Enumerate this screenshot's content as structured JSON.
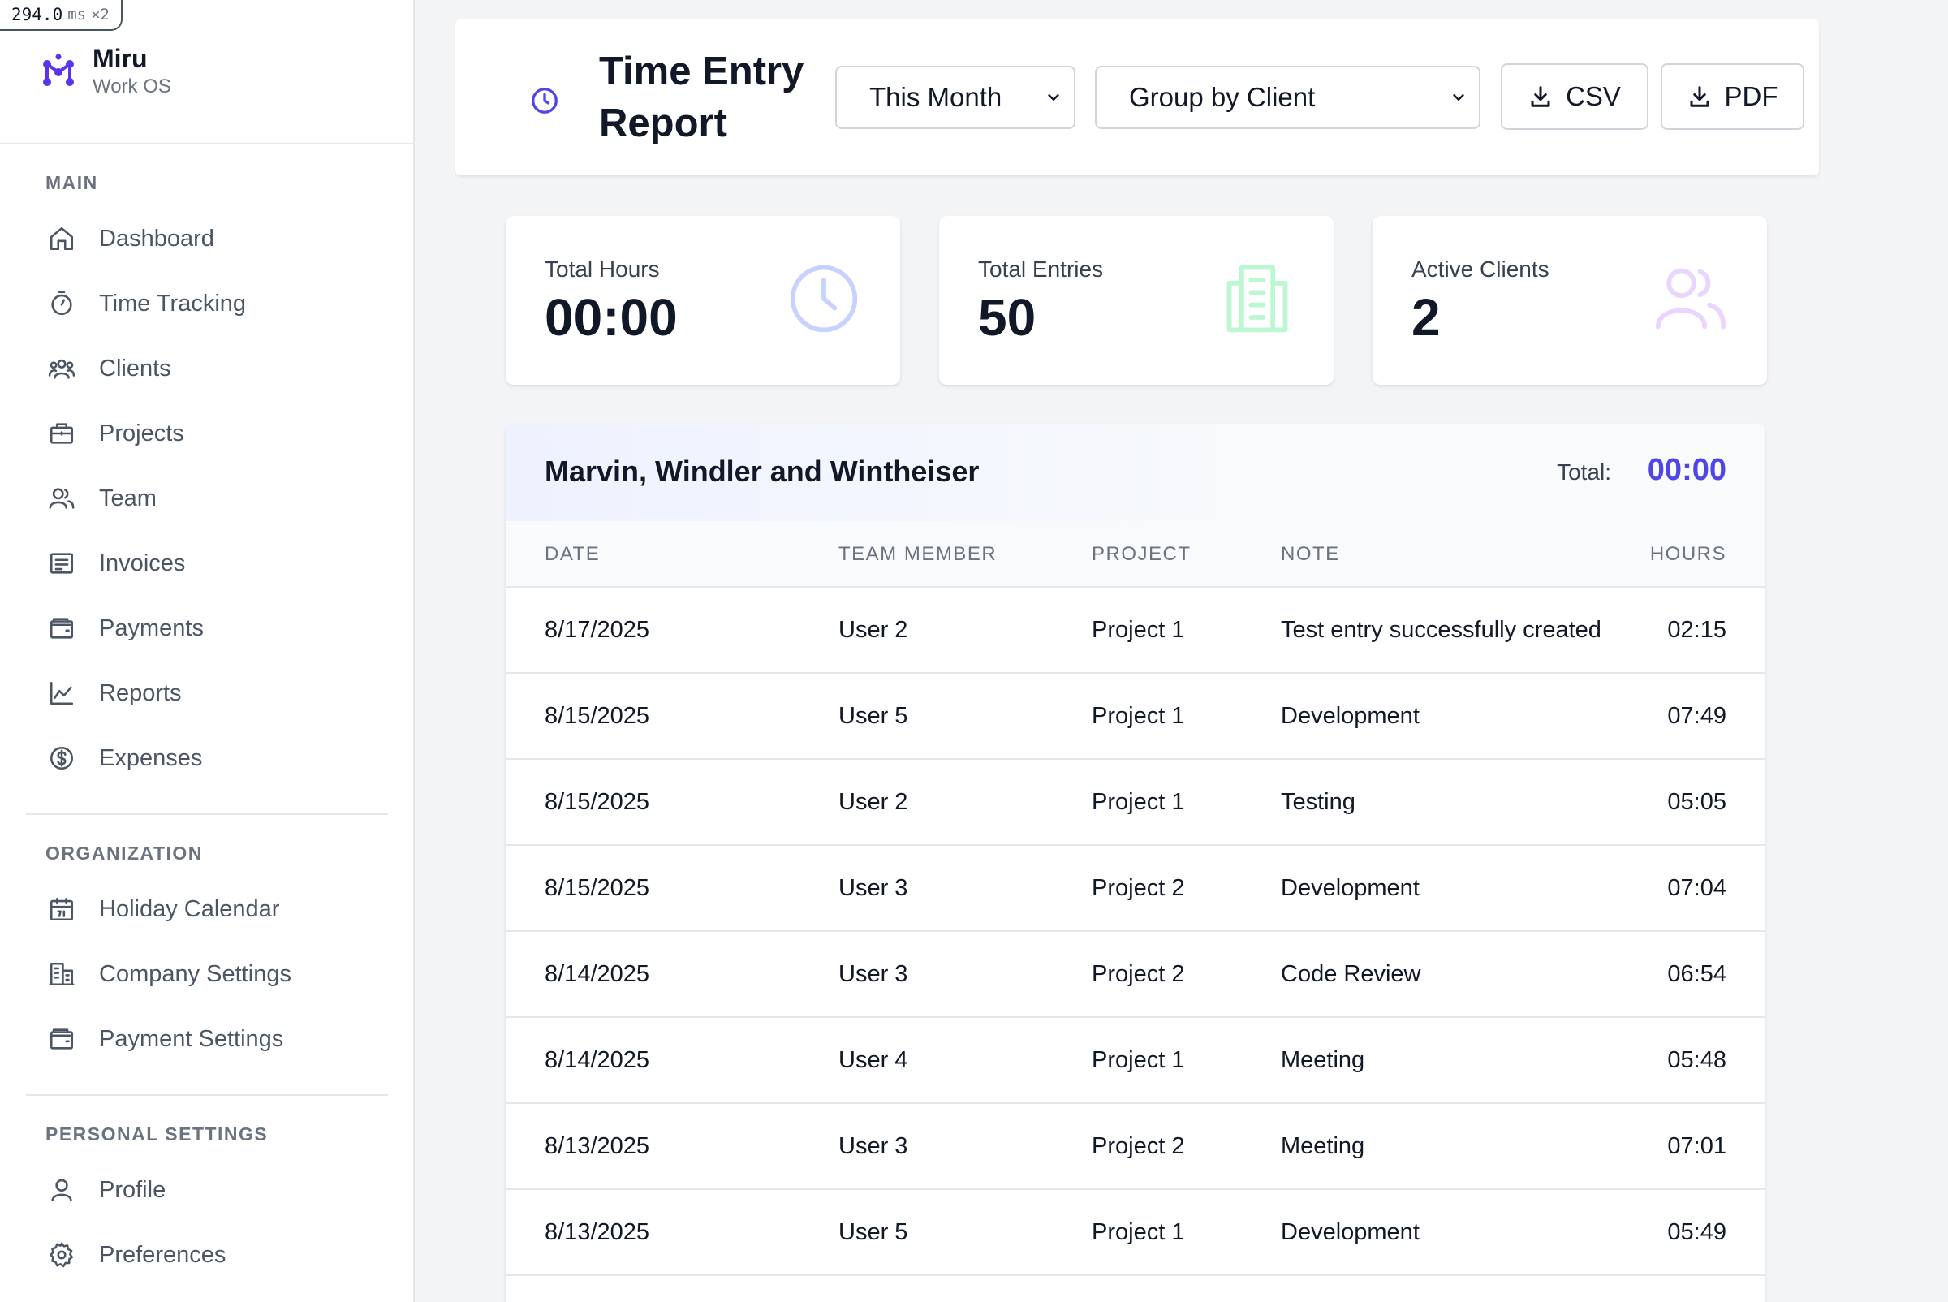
{
  "perf": {
    "value": "294.0",
    "unit": "ms",
    "multiplier": "×2"
  },
  "brand": {
    "name": "Miru",
    "subtitle": "Work OS",
    "color": "#5b34ea"
  },
  "sidebar": {
    "main": {
      "heading": "MAIN",
      "items": [
        {
          "label": "Dashboard",
          "icon": "home-icon"
        },
        {
          "label": "Time Tracking",
          "icon": "stopwatch-icon"
        },
        {
          "label": "Clients",
          "icon": "users-group-icon"
        },
        {
          "label": "Projects",
          "icon": "briefcase-icon"
        },
        {
          "label": "Team",
          "icon": "team-icon"
        },
        {
          "label": "Invoices",
          "icon": "invoice-icon"
        },
        {
          "label": "Payments",
          "icon": "wallet-icon"
        },
        {
          "label": "Reports",
          "icon": "chart-line-icon"
        },
        {
          "label": "Expenses",
          "icon": "dollar-circle-icon"
        }
      ]
    },
    "organization": {
      "heading": "ORGANIZATION",
      "items": [
        {
          "label": "Holiday Calendar",
          "icon": "calendar-icon"
        },
        {
          "label": "Company Settings",
          "icon": "building-icon"
        },
        {
          "label": "Payment Settings",
          "icon": "wallet-icon"
        }
      ]
    },
    "personal": {
      "heading": "PERSONAL SETTINGS",
      "items": [
        {
          "label": "Profile",
          "icon": "user-icon"
        },
        {
          "label": "Preferences",
          "icon": "gear-icon"
        }
      ]
    }
  },
  "header": {
    "title": "Time Entry Report",
    "icon": "clock-icon",
    "period_select": "This Month",
    "group_select": "Group by Client",
    "csv_label": "CSV",
    "pdf_label": "PDF"
  },
  "stats": [
    {
      "label": "Total Hours",
      "value": "00:00",
      "icon": "clock-icon",
      "icon_color": "#c7d2fe"
    },
    {
      "label": "Total Entries",
      "value": "50",
      "icon": "document-icon",
      "icon_color": "#bbf7d0"
    },
    {
      "label": "Active Clients",
      "value": "2",
      "icon": "users-icon",
      "icon_color": "#e9d5ff"
    }
  ],
  "report": {
    "client": "Marvin, Windler and Wintheiser",
    "total_label": "Total:",
    "total_value": "00:00",
    "accent": "#4f46e5",
    "columns": {
      "date": "DATE",
      "member": "TEAM MEMBER",
      "project": "PROJECT",
      "note": "NOTE",
      "hours": "HOURS"
    },
    "rows": [
      {
        "date": "8/17/2025",
        "member": "User 2",
        "project": "Project 1",
        "note": "Test entry successfully created",
        "hours": "02:15"
      },
      {
        "date": "8/15/2025",
        "member": "User 5",
        "project": "Project 1",
        "note": "Development",
        "hours": "07:49"
      },
      {
        "date": "8/15/2025",
        "member": "User 2",
        "project": "Project 1",
        "note": "Testing",
        "hours": "05:05"
      },
      {
        "date": "8/15/2025",
        "member": "User 3",
        "project": "Project 2",
        "note": "Development",
        "hours": "07:04"
      },
      {
        "date": "8/14/2025",
        "member": "User 3",
        "project": "Project 2",
        "note": "Code Review",
        "hours": "06:54"
      },
      {
        "date": "8/14/2025",
        "member": "User 4",
        "project": "Project 1",
        "note": "Meeting",
        "hours": "05:48"
      },
      {
        "date": "8/13/2025",
        "member": "User 3",
        "project": "Project 2",
        "note": "Meeting",
        "hours": "07:01"
      },
      {
        "date": "8/13/2025",
        "member": "User 5",
        "project": "Project 1",
        "note": "Development",
        "hours": "05:49"
      },
      {
        "date": "",
        "member": "",
        "project": "",
        "note": "",
        "hours": ""
      }
    ]
  }
}
